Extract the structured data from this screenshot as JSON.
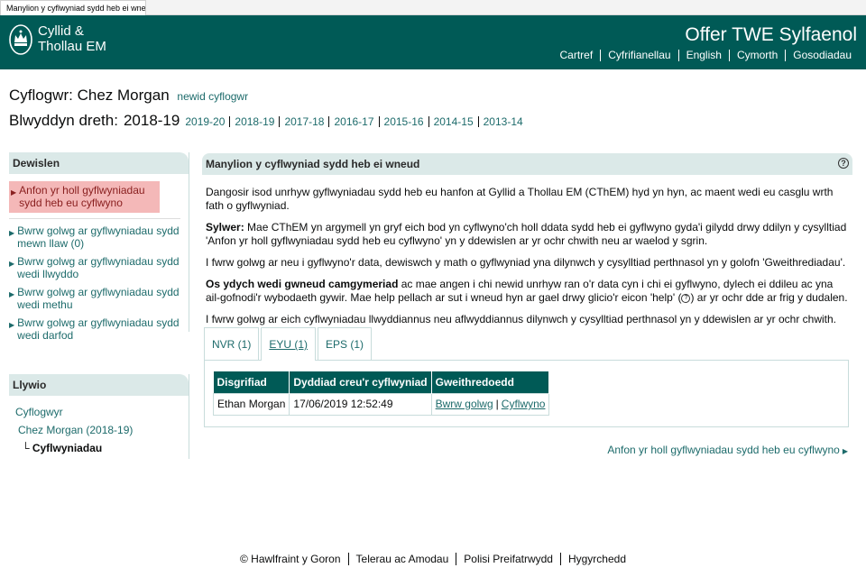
{
  "browser": {
    "tab_title": "Manylion y cyflwyniad sydd heb ei wneud"
  },
  "header": {
    "logo_line1": "Cyllid &",
    "logo_line2": "Thollau EM",
    "service_name": "Offer TWE Sylfaenol",
    "nav": [
      "Cartref",
      "Cyfrifianellau",
      "English",
      "Cymorth",
      "Gosodiadau"
    ],
    "brand_color": "#005a56"
  },
  "employer": {
    "label": "Cyflogwr:",
    "name": "Chez Morgan",
    "change_link": "newid cyflogwr"
  },
  "tax_year": {
    "label": "Blwyddyn dreth:",
    "current": "2018-19",
    "years": [
      "2019-20",
      "2018-19",
      "2017-18",
      "2016-17",
      "2015-16",
      "2014-15",
      "2013-14"
    ]
  },
  "menu": {
    "title": "Dewislen",
    "active_item": "Anfon yr holl gyflwyniadau sydd heb eu cyflwyno",
    "items": [
      "Bwrw golwg ar gyflwyniadau sydd mewn llaw (0)",
      "Bwrw golwg ar gyflwyniadau sydd wedi llwyddo",
      "Bwrw golwg ar gyflwyniadau sydd wedi methu",
      "Bwrw golwg ar gyflwyniadau sydd wedi darfod"
    ]
  },
  "navigation": {
    "title": "Llywio",
    "level1": "Cyflogwyr",
    "level2": "Chez Morgan (2018-19)",
    "level3": "Cyflwyniadau"
  },
  "main": {
    "title": "Manylion y cyflwyniad sydd heb ei wneud",
    "para1": "Dangosir isod unrhyw gyflwyniadau sydd heb eu hanfon at Gyllid a Thollau EM (CThEM) hyd yn hyn, ac maent wedi eu casglu wrth fath o gyflwyniad.",
    "note_label": "Sylwer:",
    "note_text": " Mae CThEM yn argymell yn gryf eich bod yn cyflwyno'ch holl ddata sydd heb ei gyflwyno gyda'i gilydd drwy ddilyn y cysylltiad 'Anfon yr holl gyflwyniadau sydd heb eu cyflwyno' yn y ddewislen ar yr ochr chwith neu ar waelod y sgrin.",
    "para3": "I fwrw golwg ar neu i gyflwyno'r data, dewiswch y math o gyflwyniad yna dilynwch y cysylltiad perthnasol yn y golofn 'Gweithrediadau'.",
    "mistake_label": "Os ydych wedi gwneud camgymeriad",
    "mistake_text": " ac mae angen i chi newid unrhyw ran o'r data cyn i chi ei gyflwyno, dylech ei ddileu ac yna ail-gofnodi'r wybodaeth gywir. Mae help pellach ar sut i wneud hyn ar gael drwy glicio'r eicon 'help' (",
    "mistake_text2": ") ar yr ochr dde ar frig y dudalen.",
    "para5": "I fwrw golwg ar eich cyflwyniadau llwyddiannus neu aflwyddiannus dilynwch y cysylltiad perthnasol yn y ddewislen ar yr ochr chwith.",
    "help_icon_glyph": "?"
  },
  "tabs": [
    "NVR (1)",
    "EYU (1)",
    "EPS (1)"
  ],
  "table": {
    "headers": [
      "Disgrifiad",
      "Dyddiad creu'r cyflwyniad",
      "Gweithredoedd"
    ],
    "rows": [
      {
        "description": "Ethan Morgan",
        "created": "17/06/2019 12:52:49",
        "view": "Bwrw golwg",
        "submit": "Cyflwyno"
      }
    ]
  },
  "send_all_link": "Anfon yr holl gyflwyniadau sydd heb eu cyflwyno",
  "footer": [
    "© Hawlfraint y Goron",
    "Telerau ac Amodau",
    "Polisi Preifatrwydd",
    "Hygyrchedd"
  ]
}
